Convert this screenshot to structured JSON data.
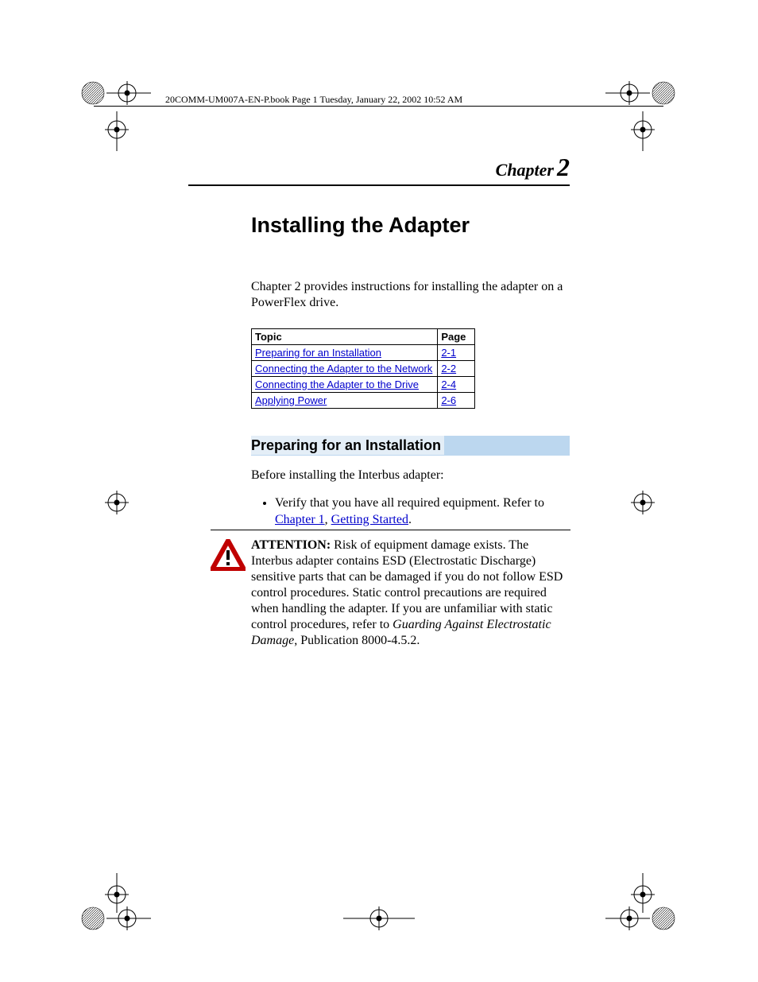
{
  "header_line": "20COMM-UM007A-EN-P.book  Page 1  Tuesday, January 22, 2002  10:52 AM",
  "chapter": {
    "word": "Chapter",
    "num": "2"
  },
  "title": "Installing the Adapter",
  "intro": "Chapter 2 provides instructions for installing the adapter on a PowerFlex drive.",
  "table": {
    "headers": {
      "topic": "Topic",
      "page": "Page"
    },
    "rows": [
      {
        "topic": "Preparing for an Installation",
        "page": "2-1"
      },
      {
        "topic": "Connecting the Adapter to the Network",
        "page": "2-2"
      },
      {
        "topic": "Connecting the Adapter to the Drive",
        "page": "2-4"
      },
      {
        "topic": "Applying Power",
        "page": "2-6"
      }
    ]
  },
  "section_heading": "Preparing for an Installation",
  "section_lead": "Before installing the Interbus adapter:",
  "bullet": {
    "pre": "Verify that you have all required equipment. Refer to ",
    "link1": "Chapter 1",
    "mid": ", ",
    "link2": "Getting Started",
    "post": "."
  },
  "attention": {
    "label": "ATTENTION:",
    "body_pre": "  Risk of equipment damage exists. The Interbus adapter contains ESD (Electrostatic Discharge) sensitive parts that can be damaged if you do not follow ESD control procedures. Static control precautions are required when handling the adapter. If you are unfamiliar with static control procedures, refer to ",
    "italic": "Guarding Against Electrostatic Damage",
    "body_post": ", Publication 8000-4.5.2."
  }
}
